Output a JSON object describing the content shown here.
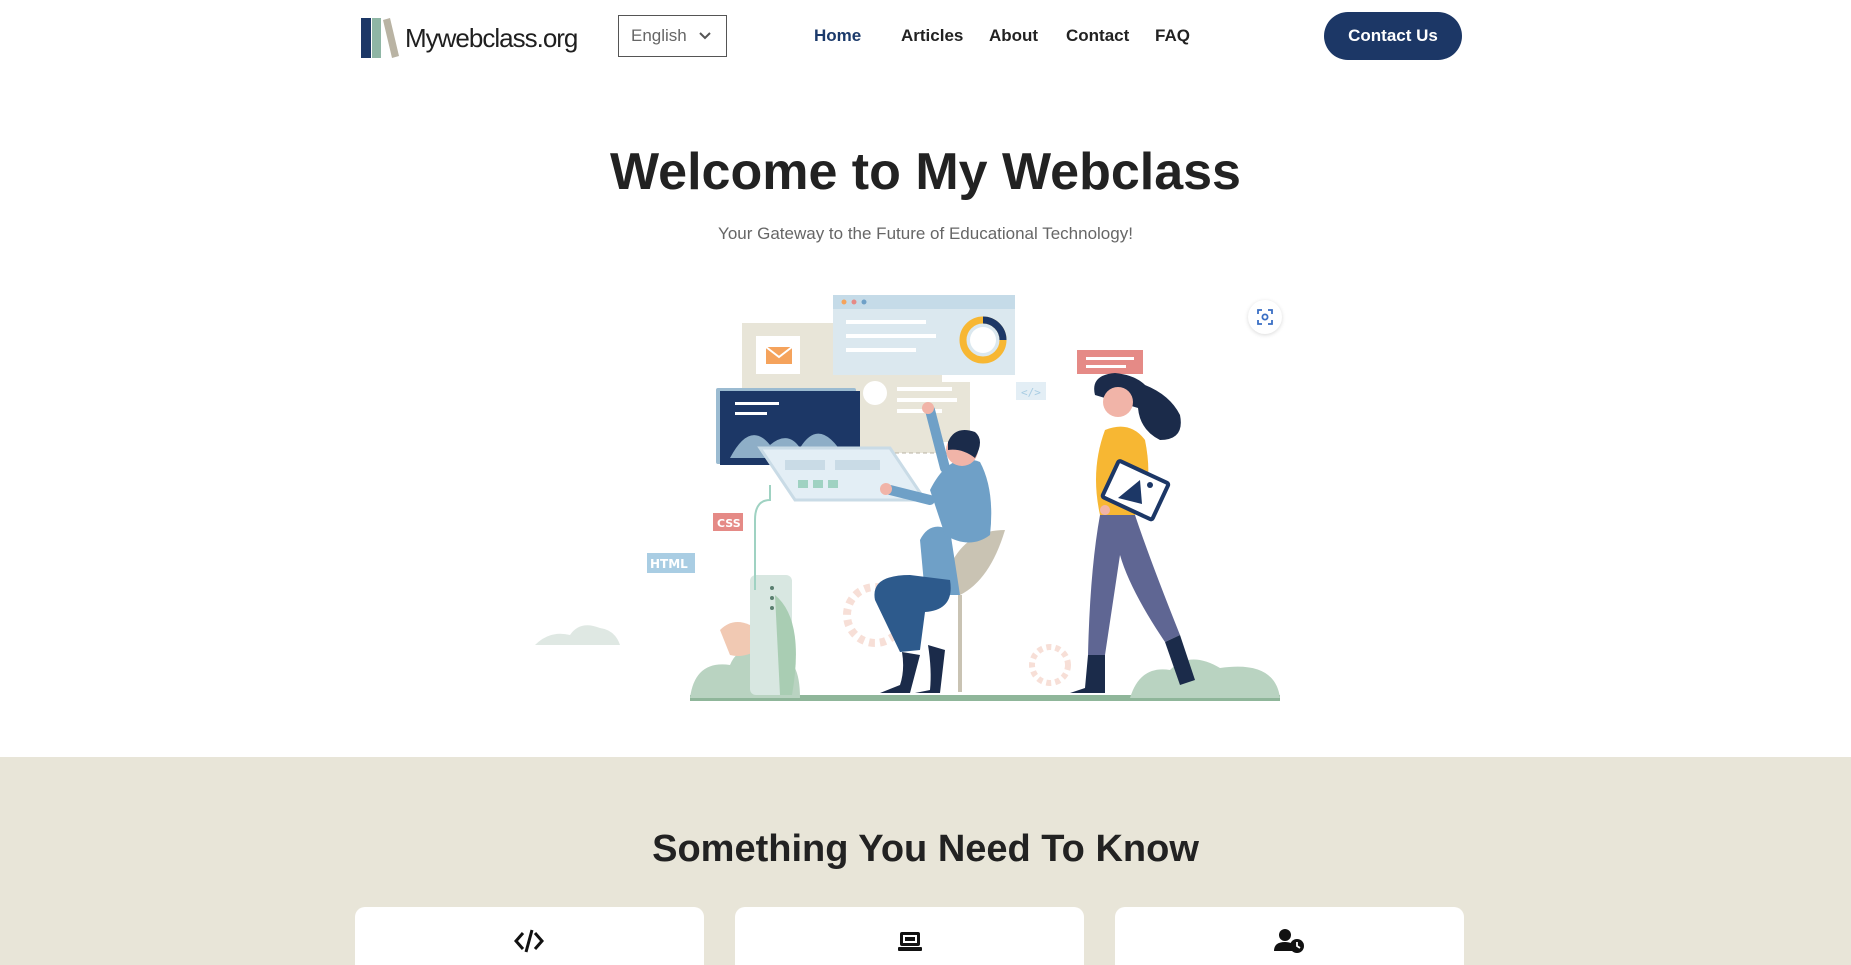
{
  "header": {
    "logo_text": "Mywebclass.org",
    "language": "English",
    "nav": [
      "Home",
      "Articles",
      "About",
      "Contact",
      "FAQ"
    ],
    "cta_label": "Contact Us"
  },
  "hero": {
    "title": "Welcome to My Webclass",
    "subtitle": "Your Gateway to the Future of Educational Technology!",
    "illustration_labels": [
      "CSS",
      "HTML"
    ]
  },
  "section": {
    "title": "Something You Need To Know",
    "cards": [
      {
        "icon": "code-icon"
      },
      {
        "icon": "computer-icon"
      },
      {
        "icon": "user-clock-icon"
      }
    ]
  },
  "colors": {
    "brand": "#1c3766",
    "band": "#e8e5d8",
    "accent_pink": "#e58a86",
    "accent_blue": "#a9cde3"
  }
}
